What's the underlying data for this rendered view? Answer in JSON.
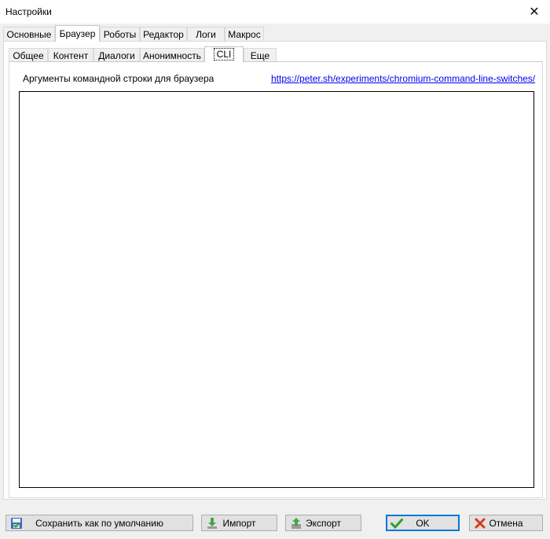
{
  "window": {
    "title": "Настройки",
    "close_glyph": "✕"
  },
  "main_tabs": [
    {
      "label": "Основные"
    },
    {
      "label": "Браузер"
    },
    {
      "label": "Роботы"
    },
    {
      "label": "Редактор"
    },
    {
      "label": "Логи"
    },
    {
      "label": "Макрос"
    }
  ],
  "main_tabs_active": "Браузер",
  "sub_tabs": [
    {
      "label": "Общее"
    },
    {
      "label": "Контент"
    },
    {
      "label": "Диалоги"
    },
    {
      "label": "Анонимность"
    },
    {
      "label": "CLI"
    },
    {
      "label": "Еще"
    }
  ],
  "sub_tabs_active": "CLI",
  "cli": {
    "label": "Аргументы командной строки для браузера",
    "link": "https://peter.sh/experiments/chromium-command-line-switches/",
    "value": ""
  },
  "buttons": {
    "save_default": "Сохранить как по умолчанию",
    "import": "Импорт",
    "export": "Экспорт",
    "ok": "OK",
    "cancel": "Отмена"
  },
  "colors": {
    "link": "#0000ee",
    "ok_check": "#2e9e2e",
    "cancel_x": "#d83a1e",
    "default_button_border": "#0078d7"
  }
}
